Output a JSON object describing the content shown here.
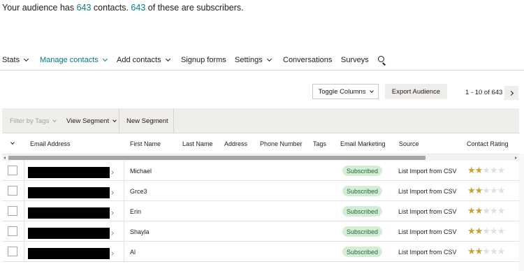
{
  "summary": {
    "prefix": "Your audience has ",
    "contacts_count": "643",
    "middle": " contacts. ",
    "subscribers_count": "643",
    "suffix": " of these are subscribers."
  },
  "nav": {
    "stats": "Stats",
    "manage_contacts": "Manage contacts",
    "add_contacts": "Add contacts",
    "signup_forms": "Signup forms",
    "settings": "Settings",
    "conversations": "Conversations",
    "surveys": "Surveys"
  },
  "toolbar": {
    "toggle_columns": "Toggle Columns",
    "export_audience": "Export Audience",
    "pagination": "1 - 10 of 643"
  },
  "filterbar": {
    "filter_by_tags": "Filter by Tags",
    "view_segment": "View Segment",
    "new_segment": "New Segment"
  },
  "table": {
    "columns": {
      "email": "Email Address",
      "first_name": "First Name",
      "last_name": "Last Name",
      "address": "Address",
      "phone": "Phone Number",
      "tags": "Tags",
      "email_marketing": "Email Marketing",
      "source": "Source",
      "rating": "Contact Rating"
    },
    "rows": [
      {
        "first_name": "Michael",
        "status": "Subscribed",
        "source": "List Import from CSV",
        "rating": 2
      },
      {
        "first_name": "Grce3",
        "status": "Subscribed",
        "source": "List Import from CSV",
        "rating": 2
      },
      {
        "first_name": "Erin",
        "status": "Subscribed",
        "source": "List Import from CSV",
        "rating": 2
      },
      {
        "first_name": "Shayla",
        "status": "Subscribed",
        "source": "List Import from CSV",
        "rating": 2
      },
      {
        "first_name": "Al",
        "status": "Subscribed",
        "source": "List Import from CSV",
        "rating": 2
      }
    ],
    "rating_max": 5
  },
  "colors": {
    "accent": "#007c89",
    "subscribed_bg": "#d4eed6",
    "star_on": "#c9a22f",
    "star_off": "#e0e0e0"
  }
}
